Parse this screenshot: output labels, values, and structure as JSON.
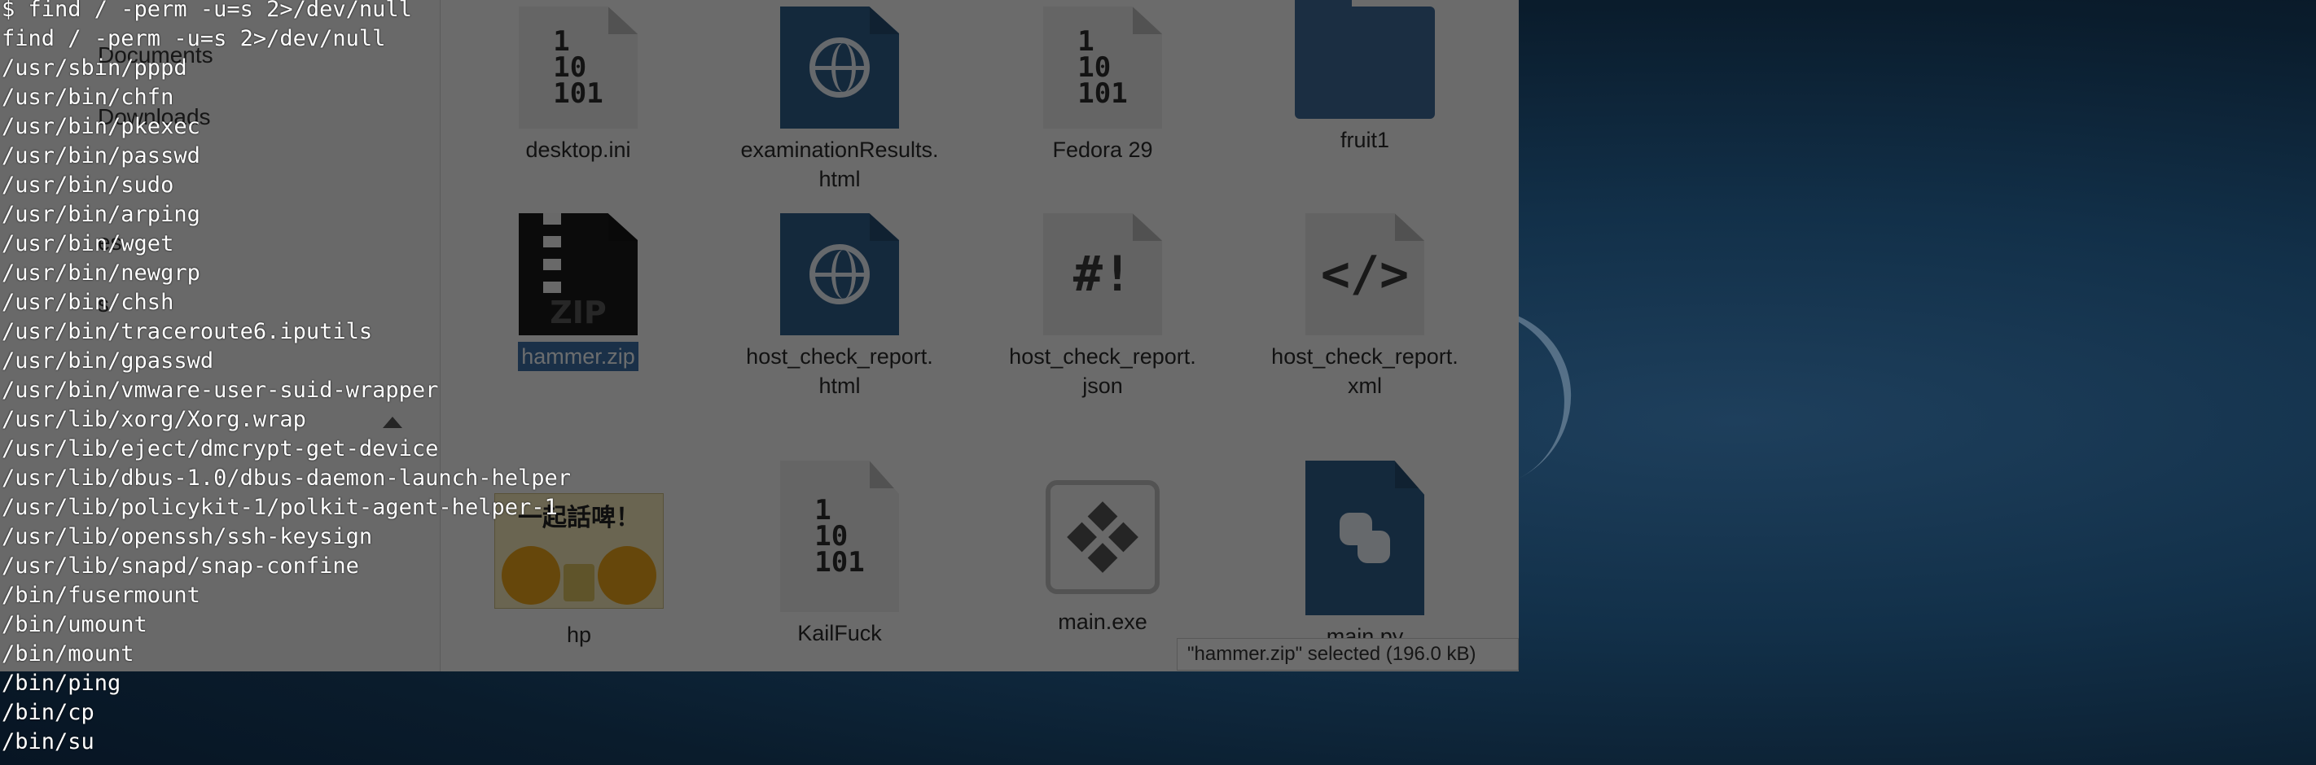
{
  "terminal": {
    "lines": [
      "$ find / -perm -u=s 2>/dev/null",
      "find / -perm -u=s 2>/dev/null",
      "/usr/sbin/pppd",
      "/usr/bin/chfn",
      "/usr/bin/pkexec",
      "/usr/bin/passwd",
      "/usr/bin/sudo",
      "/usr/bin/arping",
      "/usr/bin/wget",
      "/usr/bin/newgrp",
      "/usr/bin/chsh",
      "/usr/bin/traceroute6.iputils",
      "/usr/bin/gpasswd",
      "/usr/bin/vmware-user-suid-wrapper",
      "/usr/lib/xorg/Xorg.wrap",
      "/usr/lib/eject/dmcrypt-get-device",
      "/usr/lib/dbus-1.0/dbus-daemon-launch-helper",
      "/usr/lib/policykit-1/polkit-agent-helper-1",
      "/usr/lib/openssh/ssh-keysign",
      "/usr/lib/snapd/snap-confine",
      "/bin/fusermount",
      "/bin/umount",
      "/bin/mount",
      "/bin/ping",
      "/bin/cp",
      "/bin/su"
    ]
  },
  "sidebar": {
    "items": [
      {
        "label": "Documents"
      },
      {
        "label": "Downloads"
      },
      {
        "label": "es"
      },
      {
        "label": "s"
      }
    ]
  },
  "files": [
    {
      "name": "desktop.ini",
      "icon": "binary-file-icon",
      "selected": false
    },
    {
      "name": "examinationResults.\nhtml",
      "icon": "html-file-icon",
      "selected": false
    },
    {
      "name": "Fedora 29",
      "icon": "binary-file-icon",
      "selected": false
    },
    {
      "name": "fruit1",
      "icon": "folder-icon",
      "selected": false
    },
    {
      "name": "hammer.zip",
      "icon": "zip-file-icon",
      "selected": true
    },
    {
      "name": "host_check_report.\nhtml",
      "icon": "html-file-icon",
      "selected": false
    },
    {
      "name": "host_check_report.\njson",
      "icon": "script-file-icon",
      "selected": false
    },
    {
      "name": "host_check_report.\nxml",
      "icon": "code-file-icon",
      "selected": false
    },
    {
      "name": "hp",
      "icon": "image-thumbnail",
      "selected": false
    },
    {
      "name": "KailFuck",
      "icon": "binary-file-icon",
      "selected": false
    },
    {
      "name": "main.exe",
      "icon": "executable-icon",
      "selected": false
    },
    {
      "name": "main.py",
      "icon": "python-file-icon",
      "selected": false
    }
  ],
  "icon_text": {
    "binary": "1\n10\n101",
    "zip": "ZIP",
    "json_glyph": "#!",
    "xml_glyph": "</>",
    "hp_caption": "一起話啤！"
  },
  "status_bar": {
    "text": "\"hammer.zip\" selected  (196.0 kB)"
  },
  "colors": {
    "terminal_text": "#ffffff",
    "selection": "#3b6ea5",
    "desktop_bg": "#123049"
  }
}
